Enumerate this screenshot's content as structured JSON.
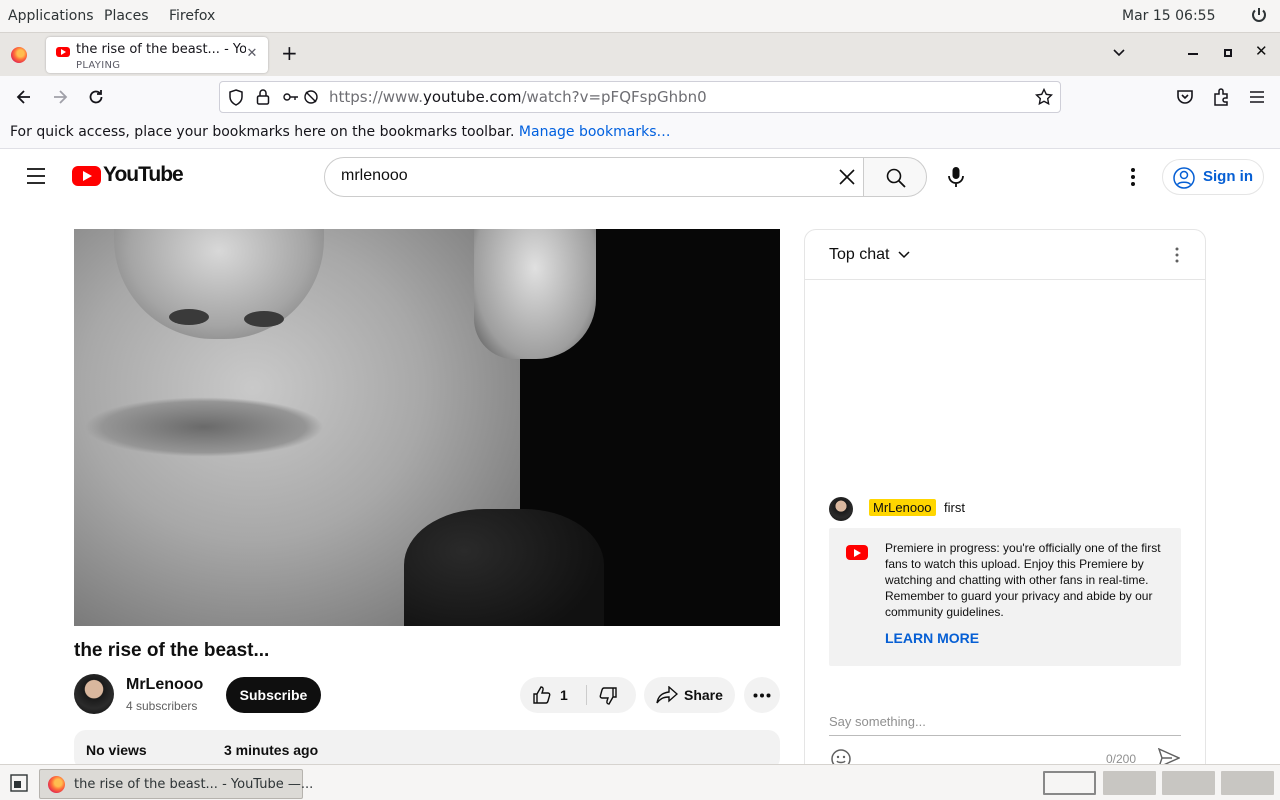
{
  "desktop": {
    "menus": [
      "Applications",
      "Places",
      "Firefox"
    ],
    "clock": "Mar 15  06:55"
  },
  "browser": {
    "tab": {
      "title": "the rise of the beast... - YouTube",
      "status": "PLAYING"
    },
    "url_prefix": "https://www.",
    "url_domain": "youtube.com",
    "url_path": "/watch?v=pFQFspGhbn0",
    "bookmarks_text": "For quick access, place your bookmarks here on the bookmarks toolbar.",
    "bookmarks_link": "Manage bookmarks…"
  },
  "youtube": {
    "logo_text": "YouTube",
    "search_value": "mrlenooo",
    "sign_in": "Sign in"
  },
  "video": {
    "title": "the rise of the beast...",
    "channel": "MrLenooo",
    "subscribers": "4 subscribers",
    "subscribe_label": "Subscribe",
    "likes": "1",
    "share_label": "Share",
    "views": "No views",
    "posted": "3 minutes ago"
  },
  "chat": {
    "header": "Top chat",
    "message": {
      "author": "MrLenooo",
      "text": "first"
    },
    "notice": "Premiere in progress: you're officially one of the first fans to watch this upload. Enjoy this Premiere by watching and chatting with other fans in real-time. Remember to guard your privacy and abide by our community guidelines.",
    "learn_more": "LEARN MORE",
    "input_placeholder": "Say something...",
    "counter": "0/200"
  },
  "taskbar": {
    "window_title": "the rise of the beast... - YouTube —..."
  },
  "colors": {
    "youtube_red": "#ff0000",
    "link_blue": "#065fd4",
    "author_badge": "#ffd600",
    "firefox_link": "#0060df"
  }
}
